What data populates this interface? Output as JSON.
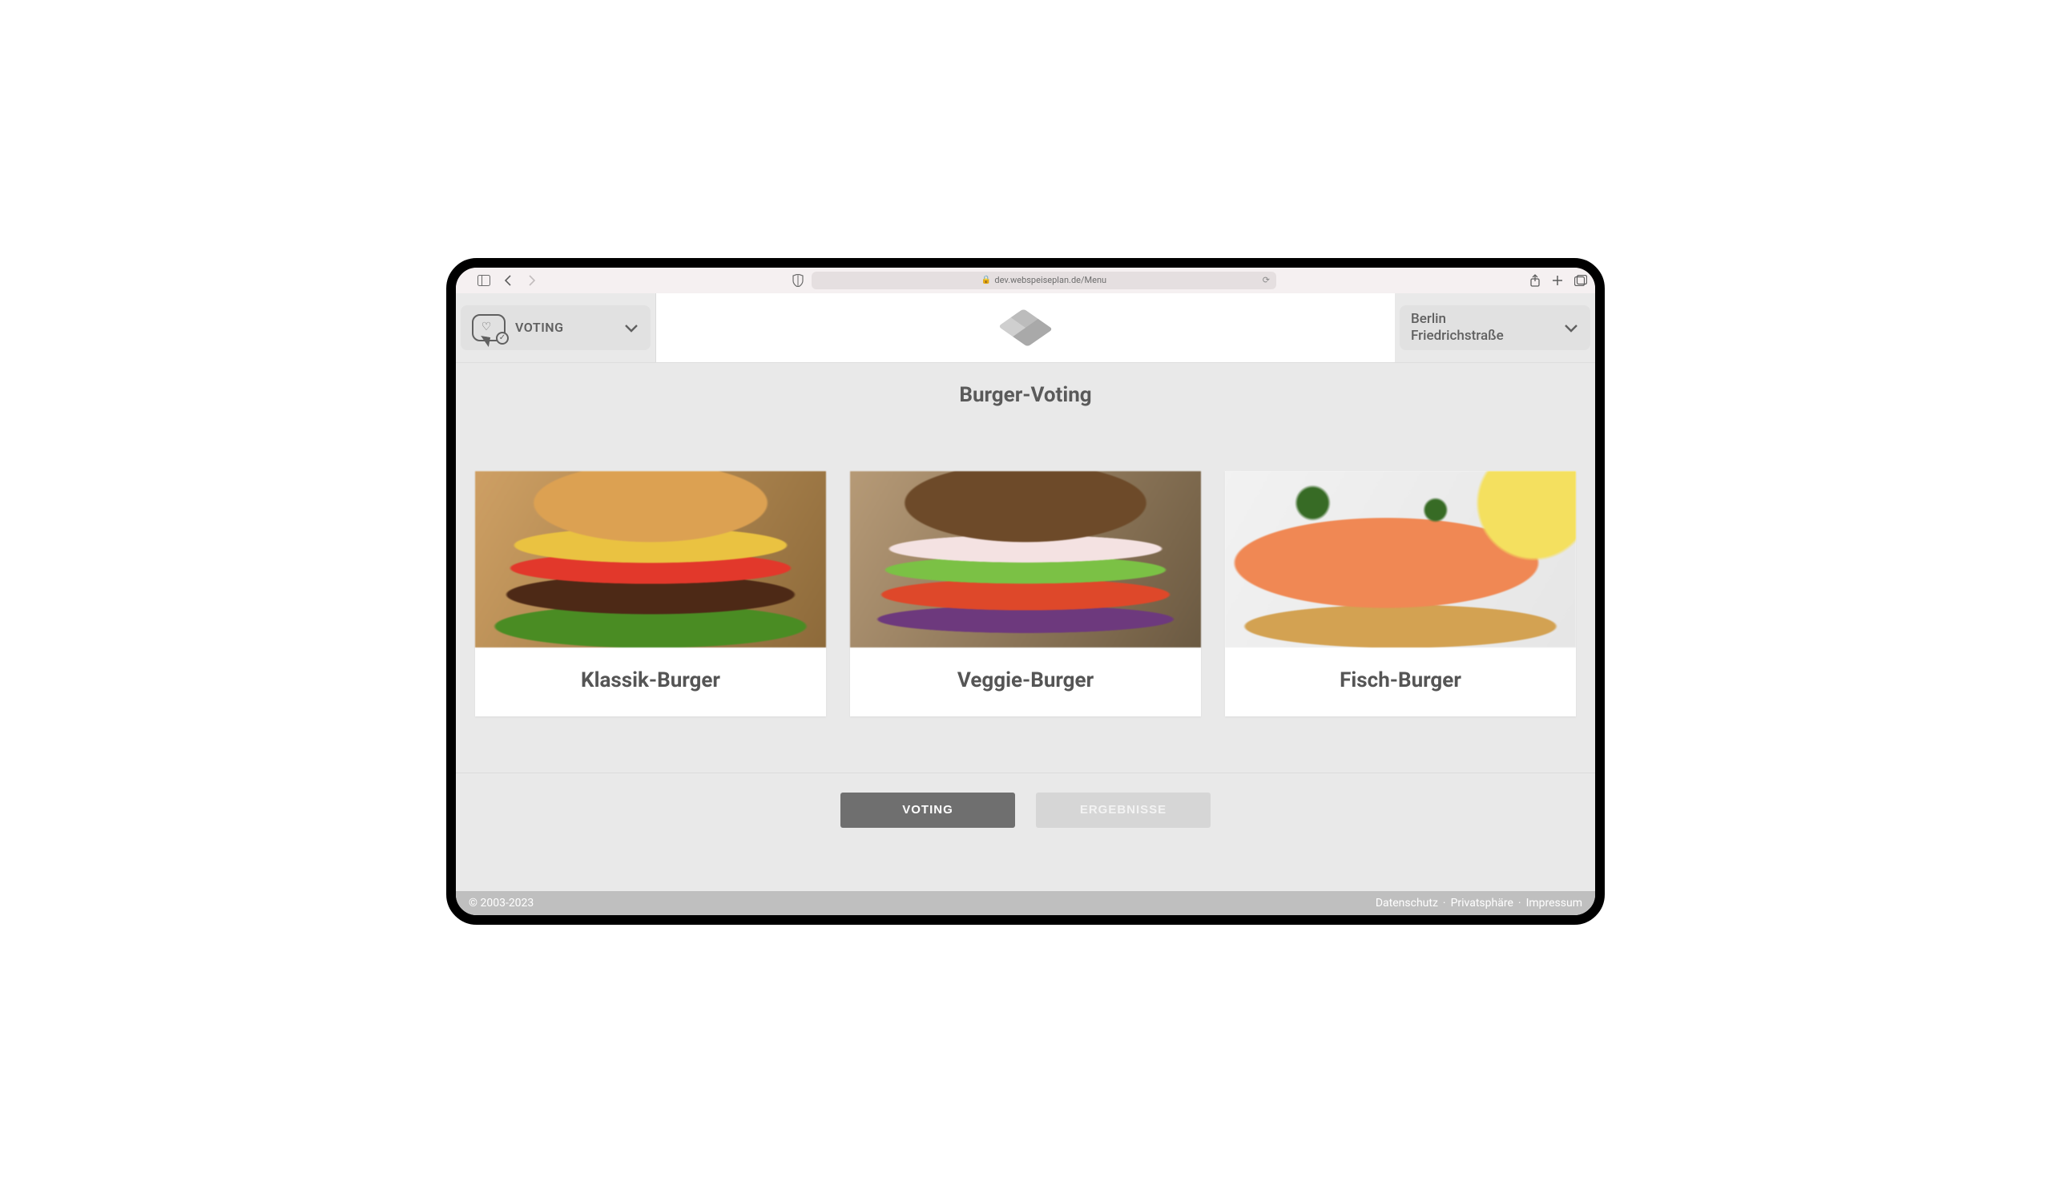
{
  "browser": {
    "url_display": "dev.webspeiseplan.de/Menu"
  },
  "header": {
    "mode_dropdown": {
      "label": "VOTING"
    },
    "location_dropdown": {
      "line1": "Berlin",
      "line2": "Friedrichstraße"
    }
  },
  "main": {
    "title": "Burger-Voting",
    "cards": [
      {
        "name": "Klassik-Burger"
      },
      {
        "name": "Veggie-Burger"
      },
      {
        "name": "Fisch-Burger"
      }
    ],
    "tabs": {
      "voting": "VOTING",
      "results": "ERGEBNISSE"
    }
  },
  "footer": {
    "copyright": "© 2003-2023",
    "links": {
      "privacy": "Datenschutz",
      "privacy2": "Privatsphäre",
      "imprint": "Impressum"
    }
  }
}
